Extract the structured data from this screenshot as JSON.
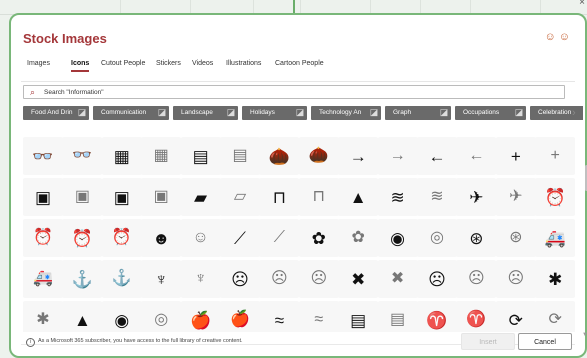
{
  "window": {
    "close_glyph": "×"
  },
  "dialog": {
    "title": "Stock Images",
    "header_icons": [
      "smiley-icon",
      "smiley-icon"
    ],
    "accent": "#a4373a",
    "border_color": "#79b779"
  },
  "tabs": [
    {
      "label": "Images",
      "active": false
    },
    {
      "label": "Icons",
      "active": true
    },
    {
      "label": "Cutout People",
      "active": false
    },
    {
      "label": "Stickers",
      "active": false
    },
    {
      "label": "Videos",
      "active": false
    },
    {
      "label": "Illustrations",
      "active": false
    },
    {
      "label": "Cartoon People",
      "active": false
    }
  ],
  "search": {
    "value": "Search \"Information\"",
    "icon": "search-icon"
  },
  "categories": [
    {
      "label": "Food And Drin",
      "icon": "food-icon"
    },
    {
      "label": "Communication",
      "icon": "speech-bubble-icon"
    },
    {
      "label": "Landscape",
      "icon": "landscape-icon"
    },
    {
      "label": "Holidays",
      "icon": "holidays-icon"
    },
    {
      "label": "Technology An",
      "icon": "technology-icon"
    },
    {
      "label": "Graph",
      "icon": "graph-icon"
    },
    {
      "label": "Occupations",
      "icon": "occupations-icon"
    },
    {
      "label": "Celebration",
      "icon": "celebration-icon"
    }
  ],
  "icon_grid": [
    [
      {
        "n": "3d-glasses-icon",
        "g": "👓"
      },
      {
        "n": "3d-glasses-outline-icon",
        "g": "👓",
        "o": true
      },
      {
        "n": "abacus-icon",
        "g": "▦"
      },
      {
        "n": "abacus-outline-icon",
        "g": "▦",
        "o": true
      },
      {
        "n": "abacus-frame-icon",
        "g": "▤"
      },
      {
        "n": "abacus-frame-outline-icon",
        "g": "▤",
        "o": true
      },
      {
        "n": "acorn-icon",
        "g": "🌰"
      },
      {
        "n": "acorn-outline-icon",
        "g": "🌰",
        "o": true
      },
      {
        "n": "arrow-right-icon",
        "g": "→"
      },
      {
        "n": "arrow-right-outline-icon",
        "g": "→",
        "o": true
      },
      {
        "n": "arrow-left-icon",
        "g": "←"
      },
      {
        "n": "arrow-left-outline-icon",
        "g": "←",
        "o": true
      },
      {
        "n": "plus-icon",
        "g": "+"
      },
      {
        "n": "plus-outline-icon",
        "g": "+",
        "o": true
      }
    ],
    [
      {
        "n": "address-book-icon",
        "g": "▣"
      },
      {
        "n": "address-book-outline-icon",
        "g": "▣",
        "o": true
      },
      {
        "n": "address-book-2-icon",
        "g": "▣"
      },
      {
        "n": "address-book-2-outline-icon",
        "g": "▣",
        "o": true
      },
      {
        "n": "adhesive-bandage-icon",
        "g": "▰"
      },
      {
        "n": "adhesive-bandage-outline-icon",
        "g": "▱",
        "o": true
      },
      {
        "n": "billboard-icon",
        "g": "⊓"
      },
      {
        "n": "billboard-outline-icon",
        "g": "⊓",
        "o": true
      },
      {
        "n": "africa-icon",
        "g": "▲"
      },
      {
        "n": "field-icon",
        "g": "≋"
      },
      {
        "n": "field-outline-icon",
        "g": "≋",
        "o": true
      },
      {
        "n": "airplane-icon",
        "g": "✈"
      },
      {
        "n": "airplane-outline-icon",
        "g": "✈",
        "o": true
      },
      {
        "n": "alarm-clock-icon",
        "g": "⏰"
      }
    ],
    [
      {
        "n": "alarm-clock-outline-icon",
        "g": "⏰",
        "o": true
      },
      {
        "n": "alarm-ringing-icon",
        "g": "⏰"
      },
      {
        "n": "alarm-ringing-outline-icon",
        "g": "⏰",
        "o": true
      },
      {
        "n": "alien-icon",
        "g": "☻"
      },
      {
        "n": "alien-outline-icon",
        "g": "☺",
        "o": true
      },
      {
        "n": "sewing-needle-icon",
        "g": "⟋"
      },
      {
        "n": "sewing-needle-outline-icon",
        "g": "⟋",
        "o": true
      },
      {
        "n": "yarn-icon",
        "g": "✿"
      },
      {
        "n": "yarn-outline-icon",
        "g": "✿",
        "o": true
      },
      {
        "n": "measuring-tape-icon",
        "g": "◉"
      },
      {
        "n": "measuring-tape-outline-icon",
        "g": "◎",
        "o": true
      },
      {
        "n": "button-icon",
        "g": "⊛"
      },
      {
        "n": "button-outline-icon",
        "g": "⊛",
        "o": true
      },
      {
        "n": "ambulance-icon",
        "g": "🚑"
      }
    ],
    [
      {
        "n": "ambulance-outline-icon",
        "g": "🚑",
        "o": true
      },
      {
        "n": "anchor-icon",
        "g": "⚓"
      },
      {
        "n": "anchor-outline-icon",
        "g": "⚓",
        "o": true
      },
      {
        "n": "anemone-icon",
        "g": "♆"
      },
      {
        "n": "anemone-outline-icon",
        "g": "♆",
        "o": true
      },
      {
        "n": "angry-face-icon",
        "g": "☹"
      },
      {
        "n": "angry-face-outline-icon",
        "g": "☹",
        "o": true
      },
      {
        "n": "angry-face-2-outline-icon",
        "g": "☹",
        "o": true
      },
      {
        "n": "anguish-icon",
        "g": "✖"
      },
      {
        "n": "anguish-outline-icon",
        "g": "✖",
        "o": true
      },
      {
        "n": "sad-face-icon",
        "g": "☹"
      },
      {
        "n": "sad-face-outline-icon",
        "g": "☹",
        "o": true
      },
      {
        "n": "sad-face-2-outline-icon",
        "g": "☹",
        "o": true
      },
      {
        "n": "ant-icon",
        "g": "✱"
      }
    ],
    [
      {
        "n": "ant-outline-icon",
        "g": "✱",
        "o": true
      },
      {
        "n": "antarctica-icon",
        "g": "▲"
      },
      {
        "n": "aperture-icon",
        "g": "◉"
      },
      {
        "n": "aperture-outline-icon",
        "g": "◎",
        "o": true
      },
      {
        "n": "apple-icon",
        "g": "🍎"
      },
      {
        "n": "apple-outline-icon",
        "g": "🍎",
        "o": true
      },
      {
        "n": "aquarius-icon",
        "g": "≈"
      },
      {
        "n": "aquarius-outline-icon",
        "g": "≈",
        "o": true
      },
      {
        "n": "archive-icon",
        "g": "▤"
      },
      {
        "n": "archive-outline-icon",
        "g": "▤",
        "o": true
      },
      {
        "n": "aries-icon",
        "g": "♈"
      },
      {
        "n": "aries-outline-icon",
        "g": "♈",
        "o": true
      },
      {
        "n": "refresh-icon",
        "g": "⟳"
      },
      {
        "n": "refresh-outline-icon",
        "g": "⟳",
        "o": true
      }
    ]
  ],
  "footer": {
    "info_glyph": "i",
    "note": "As a Microsoft 365 subscriber, you have access to the full library of creative content.",
    "insert_label": "Insert",
    "cancel_label": "Cancel"
  }
}
